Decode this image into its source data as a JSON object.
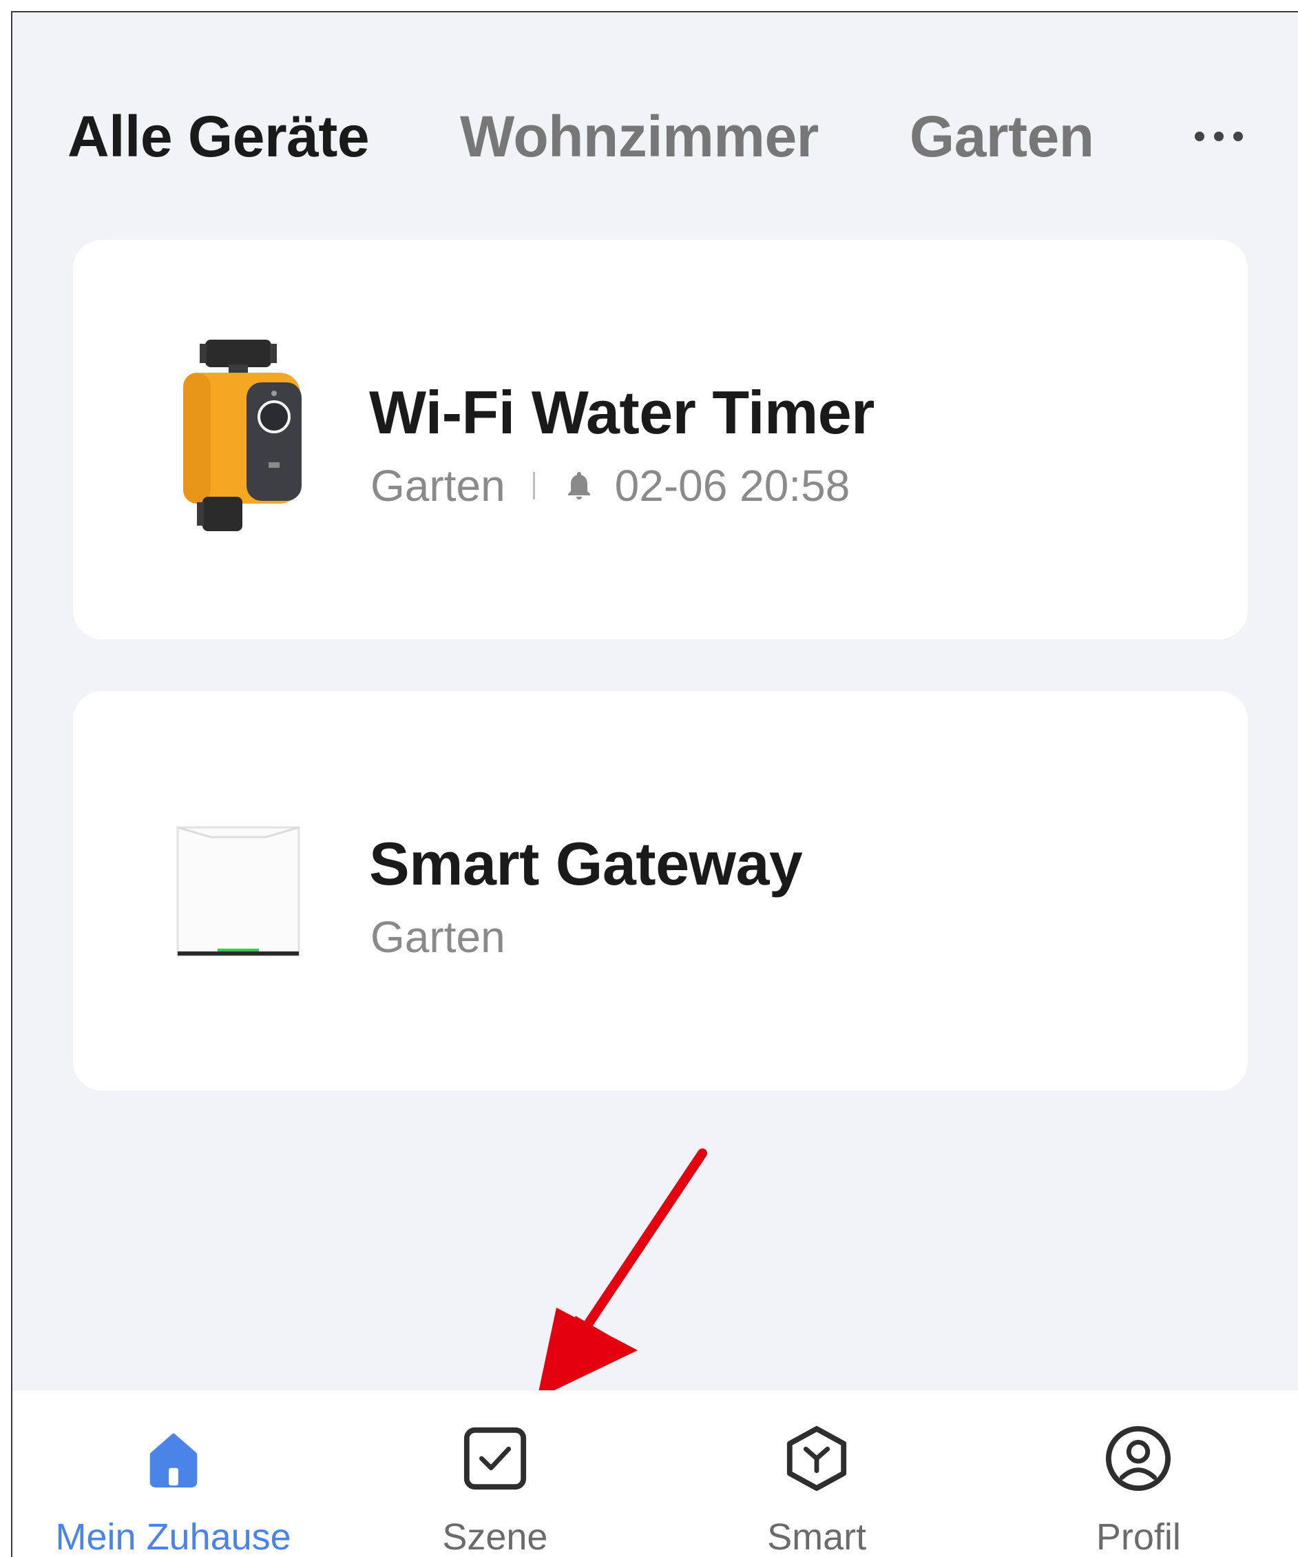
{
  "tabs": [
    {
      "label": "Alle Geräte",
      "active": true
    },
    {
      "label": "Wohnzimmer",
      "active": false
    },
    {
      "label": "Garten",
      "active": false
    }
  ],
  "more_icon": "more-horizontal-icon",
  "devices": [
    {
      "name": "Wi-Fi Water Timer",
      "room": "Garten",
      "alert_icon": "bell-icon",
      "alert_time": "02-06 20:58",
      "image": "water-timer-image"
    },
    {
      "name": "Smart Gateway",
      "room": "Garten",
      "image": "gateway-image"
    }
  ],
  "annotation": {
    "type": "arrow",
    "color": "#e3000f",
    "points_to": "Szene"
  },
  "nav": [
    {
      "label": "Mein Zuhause",
      "icon": "home-icon",
      "active": true
    },
    {
      "label": "Szene",
      "icon": "scene-checkbox-icon",
      "active": false
    },
    {
      "label": "Smart",
      "icon": "smart-cube-icon",
      "active": false
    },
    {
      "label": "Profil",
      "icon": "profile-icon",
      "active": false
    }
  ],
  "colors": {
    "accent": "#4a84e8",
    "background": "#f2f3f7",
    "card": "#ffffff",
    "timer_yellow": "#f5a623"
  }
}
